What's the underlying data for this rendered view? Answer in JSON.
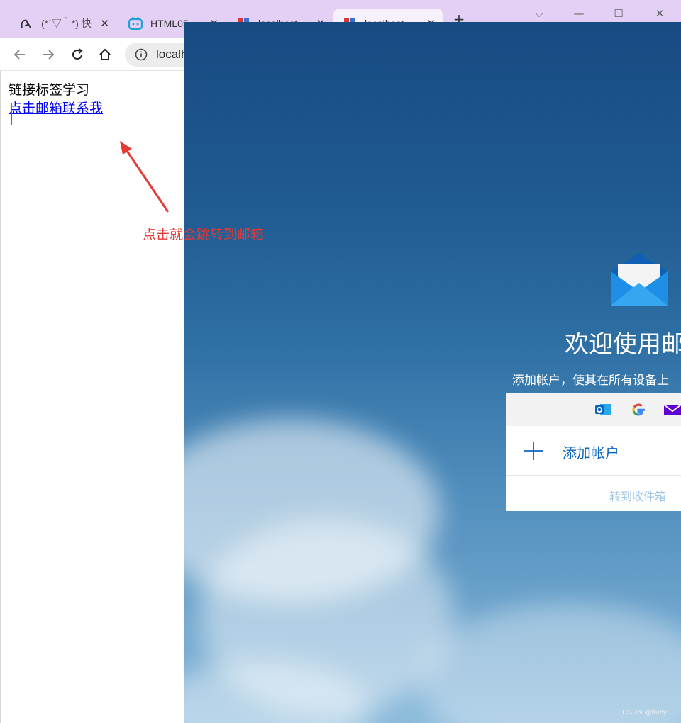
{
  "browser": {
    "tabs": [
      {
        "title": "(*´▽｀*) 快",
        "icon": "custom-logo-icon"
      },
      {
        "title": "HTML05",
        "icon": "bilibili-icon"
      },
      {
        "title": "localhost",
        "icon": "hbuilder-icon"
      },
      {
        "title": "localhost",
        "icon": "hbuilder-icon",
        "active": true
      }
    ],
    "new_tab": "+",
    "url": "localhost",
    "window_controls": {
      "dropdown": "⌵",
      "minimize": "—",
      "maximize": "☐",
      "close": "✕"
    }
  },
  "page": {
    "heading": "链接标签学习",
    "link_text": "点击邮箱联系我"
  },
  "annotation": {
    "text": "点击就会跳转到邮箱",
    "color": "#e53935"
  },
  "mail_app": {
    "welcome_title": "欢迎使用邮件",
    "subtitle": "添加帐户，使其在所有设备上",
    "providers": [
      "outlook-icon",
      "google-icon",
      "yahoo-mail-icon"
    ],
    "add_account_label": "添加帐户",
    "goto_inbox_label": "转到收件箱",
    "accent_color": "#0a64c2"
  },
  "watermark": "CSDN @huhy~"
}
